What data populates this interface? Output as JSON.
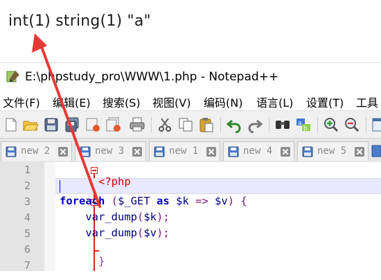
{
  "output": {
    "text": "int(1) string(1) \"a\""
  },
  "window": {
    "title": "E:\\phpstudy_pro\\WWW\\1.php - Notepad++"
  },
  "menu": {
    "items": [
      "文件(F)",
      "编辑(E)",
      "搜索(S)",
      "视图(V)",
      "编码(N)",
      "语言(L)",
      "设置(T)",
      "工具"
    ]
  },
  "toolbar": {
    "icons": [
      "new-file-icon",
      "open-file-icon",
      "save-icon",
      "save-all-icon",
      "close-icon",
      "close-all-icon",
      "print-icon",
      "cut-icon",
      "copy-icon",
      "paste-icon",
      "undo-icon",
      "redo-icon",
      "find-icon",
      "replace-icon",
      "zoom-in-icon",
      "zoom-out-icon",
      "sync-view-icon"
    ]
  },
  "tabs": [
    {
      "label": "new 2"
    },
    {
      "label": "new 3"
    },
    {
      "label": "new 1"
    },
    {
      "label": "new 4"
    },
    {
      "label": "new 5"
    }
  ],
  "editor": {
    "line_numbers": [
      "1",
      "2",
      "3",
      "4",
      "5",
      "6",
      "7"
    ],
    "code": {
      "line1": "<?php",
      "line3_kw": "foreach",
      "line3_open": " (",
      "line3_get": "$_GET",
      "line3_as": "as",
      "line3_k": "$k",
      "line3_arrow": " => ",
      "line3_v": "$v",
      "line3_close": ") {",
      "line4_fn": "var_dump",
      "line4_open": "(",
      "line4_var": "$k",
      "line4_close": ");",
      "line5_fn": "var_dump",
      "line5_open": "(",
      "line5_var": "$v",
      "line5_close": ");",
      "line6": "}"
    }
  },
  "colors": {
    "php_tag": "#e00000",
    "keyword": "#0000c0",
    "annotation_arrow": "#e53935"
  }
}
